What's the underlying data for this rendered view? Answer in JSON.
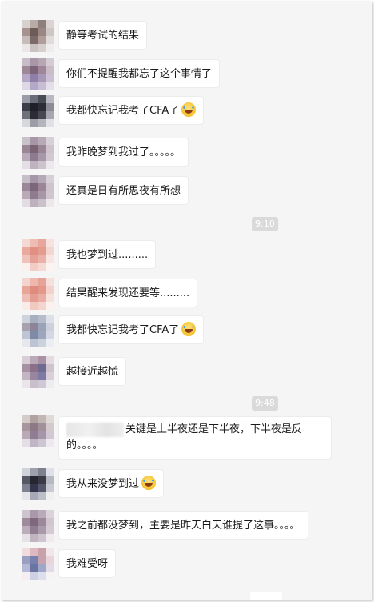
{
  "messages": [
    {
      "text": "静等考试的结果",
      "emoji": false,
      "avatar": "a1"
    },
    {
      "text": "你们不提醒我都忘了这个事情了",
      "emoji": false,
      "avatar": "a2"
    },
    {
      "text": "我都快忘记我考了CFA了",
      "emoji": true,
      "avatar": "a3"
    },
    {
      "text": "我昨晚梦到我过了。。。。。",
      "emoji": false,
      "avatar": "a4"
    },
    {
      "text": "还真是日有所思夜有所想",
      "emoji": false,
      "avatar": "a5"
    },
    {
      "timestamp": "9:10"
    },
    {
      "text": "我也梦到过.........",
      "emoji": false,
      "avatar": "a6"
    },
    {
      "text": "结果醒来发现还要等.........",
      "emoji": false,
      "avatar": "a7"
    },
    {
      "text": "我都快忘记我考了CFA了",
      "emoji": true,
      "avatar": "a8"
    },
    {
      "text": "越接近越慌",
      "emoji": false,
      "avatar": "a9"
    },
    {
      "timestamp": "9:48"
    },
    {
      "text": "关键是上半夜还是下半夜，下半夜是反的。。。。",
      "emoji": false,
      "avatar": "a10",
      "mention_blurred": true
    },
    {
      "text": "我从来没梦到过",
      "emoji": true,
      "avatar": "a11"
    },
    {
      "text": "我之前都没梦到，主要是昨天白天谁提了这事。。。。",
      "emoji": false,
      "avatar": "a12"
    },
    {
      "text": "我难受呀",
      "emoji": false,
      "avatar": "a13"
    }
  ],
  "avatars": {
    "a1": [
      "#d8d2cf",
      "#b9aba7",
      "#8d7f7c",
      "#d9d3d1",
      "#a6928e",
      "#6e5b58",
      "#9a8682",
      "#cfc7c5",
      "#c7bcb9",
      "#7b6a67",
      "#b09d99",
      "#e0dcdb",
      "#eae7e6",
      "#cbc3c1",
      "#d5cfcd",
      "#efedec"
    ],
    "a2": [
      "#c8bcc9",
      "#a996a8",
      "#b8a6b3",
      "#d5cbd3",
      "#9f8896",
      "#7e6478",
      "#a08698",
      "#c9bcc6",
      "#b6a9c7",
      "#8e7fa8",
      "#a898b8",
      "#cbbfd2",
      "#ddd8e4",
      "#b3a8c6",
      "#c7bed5",
      "#e3dfe8"
    ],
    "a3": [
      "#9a9ca6",
      "#6b6d78",
      "#4a4b55",
      "#b7b8c0",
      "#3c3d46",
      "#1f2029",
      "#2c2d37",
      "#8b8c96",
      "#6e707a",
      "#2b2c35",
      "#474852",
      "#a6a7b0",
      "#d7d8dc",
      "#9c9da6",
      "#b4b5bc",
      "#e1e2e5"
    ],
    "a4": [
      "#c9c2cb",
      "#a597a6",
      "#b7a9b6",
      "#d8d0d7",
      "#9a8796",
      "#7a6474",
      "#9a8594",
      "#cfc4cc",
      "#b9aab9",
      "#8d7a8e",
      "#a897a8",
      "#d2c8d1",
      "#e4dfe4",
      "#bfb3bf",
      "#cdc3cd",
      "#ece8ec"
    ],
    "a5": [
      "#c6bfc9",
      "#a697a8",
      "#b5a8b7",
      "#d7cfd8",
      "#9a8899",
      "#7c6679",
      "#9b8698",
      "#cfc3cd",
      "#baaab8",
      "#8e7b8d",
      "#a896a7",
      "#d1c6d0",
      "#e3dde3",
      "#bdb1bd",
      "#cbc1cb",
      "#ebe7eb"
    ],
    "a6": [
      "#f4d8d3",
      "#eebcb2",
      "#e7a79c",
      "#f6e3df",
      "#e9a99d",
      "#e08f82",
      "#e59c90",
      "#f3d6d0",
      "#efc3bb",
      "#e6a196",
      "#ebb2a9",
      "#f7e6e2",
      "#fbf0ee",
      "#f2cdc6",
      "#f5d9d3",
      "#fcf4f2"
    ],
    "a7": [
      "#f3d5cf",
      "#eeb8ad",
      "#e6a397",
      "#f5e0db",
      "#e8a598",
      "#df8b7d",
      "#e4988b",
      "#f2d2cb",
      "#eebfb6",
      "#e59d91",
      "#eaaea4",
      "#f6e2dd",
      "#faede9",
      "#f1c9c1",
      "#f4d5ce",
      "#fbf1ee"
    ],
    "a8": [
      "#cfd3dc",
      "#a8b0c0",
      "#b6bccb",
      "#dde0e7",
      "#a7a2ae",
      "#8c8598",
      "#9aa3b8",
      "#cdd1db",
      "#bfc5d3",
      "#7f8ba6",
      "#9ca7be",
      "#d4d8e2",
      "#e6e8ee",
      "#bcc3d3",
      "#ccd1de",
      "#eceef3"
    ],
    "a9": [
      "#d8cfd6",
      "#bca9b8",
      "#a992a6",
      "#e2dbe1",
      "#a591a3",
      "#8a7088",
      "#6f6a8f",
      "#cfc3cd",
      "#c4b5c2",
      "#9886a0",
      "#7d7ba3",
      "#d8cfd8",
      "#e9e5e9",
      "#c9bfcb",
      "#cfc8d6",
      "#efecef"
    ],
    "a10": [
      "#d3ccc9",
      "#b1a4a0",
      "#c2b7b4",
      "#dfd9d7",
      "#a8959b",
      "#8d7986",
      "#a2919a",
      "#d3cacd",
      "#b9aab6",
      "#8f7d94",
      "#a796ab",
      "#d1c8d3",
      "#e4dfe5",
      "#bfb5c4",
      "#cdc5d2",
      "#ede9ee"
    ],
    "a11": [
      "#d1d3da",
      "#9ea1ad",
      "#7d808d",
      "#e0e1e6",
      "#565866",
      "#25262f",
      "#3a3b46",
      "#b7b9c2",
      "#7e8190",
      "#34354a",
      "#54566b",
      "#c8cad2",
      "#e5e6ea",
      "#a7aab6",
      "#bcbec8",
      "#efeff2"
    ],
    "a12": [
      "#ccc5cd",
      "#a999a9",
      "#b9abb9",
      "#dad3da",
      "#9d8a9b",
      "#7e687b",
      "#9d889b",
      "#d1c6d0",
      "#bcadbc",
      "#907d91",
      "#aa99ab",
      "#d4cad4",
      "#e6e1e6",
      "#c0b4c1",
      "#cec4cf",
      "#eeeaee"
    ],
    "a13": [
      "#f0dcdf",
      "#ddb9c0",
      "#c9a1ab",
      "#f3e6e8",
      "#9a9fc2",
      "#7880ad",
      "#c5a2ae",
      "#e9d4d9",
      "#b4bad6",
      "#6b73a3",
      "#9fa7c9",
      "#e2dbe6",
      "#f4eef0",
      "#cdd1e3",
      "#dcdfec",
      "#f7f3f4"
    ]
  }
}
